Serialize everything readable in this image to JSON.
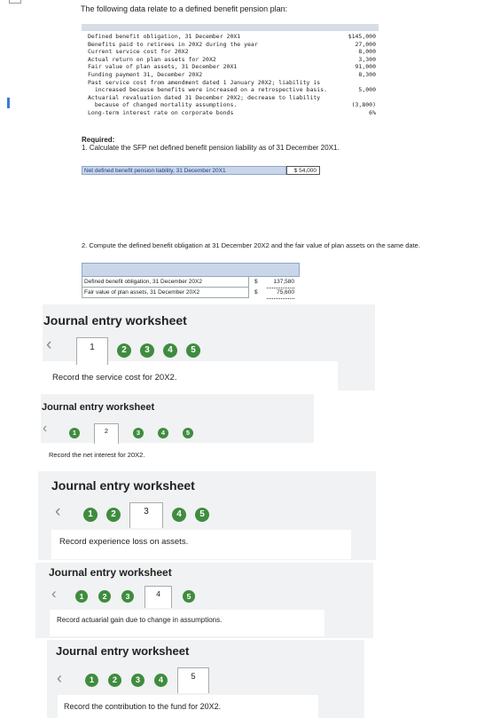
{
  "intro": "The following data relate to a defined benefit pension plan:",
  "data_table": [
    {
      "label": "Defined benefit obligation, 31 December 20X1",
      "value": "$145,000"
    },
    {
      "label": "Benefits paid to retirees in 20X2 during the year",
      "value": "27,000"
    },
    {
      "label": "Current service cost for 20X2",
      "value": "8,000"
    },
    {
      "label": "Actual return on plan assets for 20X2",
      "value": "3,300"
    },
    {
      "label": "Fair value of plan assets, 31 December 20X1",
      "value": "91,000"
    },
    {
      "label": "Funding payment 31, December 20X2",
      "value": "8,300"
    },
    {
      "label": "Past service cost from amendment dated 1 January 20X2; liability is",
      "value": ""
    },
    {
      "label": "  increased because benefits were increased on a retrospective basis.",
      "value": "5,000"
    },
    {
      "label": "Actuarial revaluation dated 31 December 20X2; decrease to liability",
      "value": ""
    },
    {
      "label": "  because of changed mortality assumptions.",
      "value": "(3,800)"
    },
    {
      "label": "Long-term interest rate on corporate bonds",
      "value": "6%"
    }
  ],
  "required": {
    "heading": "Required:",
    "q1": "1. Calculate the SFP net defined benefit pension liability as of 31 December 20X1.",
    "q1_label": "Net defined benefit pension liability, 31 December 20X1",
    "q1_value": "$ 54,000",
    "q2": "2. Compute the defined benefit obligation at 31 December 20X2 and the fair value of plan assets on the same date.",
    "q2_rows": [
      {
        "label": "Defined benefit obligation, 31 December 20X2",
        "currency": "$",
        "value": "137,580"
      },
      {
        "label": "Fair value of plan assets, 31 December 20X2",
        "currency": "$",
        "value": "75,600"
      }
    ]
  },
  "worksheets": [
    {
      "title": "Journal entry worksheet",
      "tabs": [
        "1",
        "2",
        "3",
        "4",
        "5"
      ],
      "active": 0,
      "task": "Record the service cost for 20X2."
    },
    {
      "title": "Journal entry worksheet",
      "tabs": [
        "1",
        "2",
        "3",
        "4",
        "5"
      ],
      "active": 1,
      "task": "Record the net interest for 20X2."
    },
    {
      "title": "Journal entry worksheet",
      "tabs": [
        "1",
        "2",
        "3",
        "4",
        "5"
      ],
      "active": 2,
      "task": "Record experience loss on assets."
    },
    {
      "title": "Journal entry worksheet",
      "tabs": [
        "1",
        "2",
        "3",
        "4",
        "5"
      ],
      "active": 3,
      "task": "Record actuarial gain due to change in assumptions."
    },
    {
      "title": "Journal entry worksheet",
      "tabs": [
        "1",
        "2",
        "3",
        "4",
        "5"
      ],
      "active": 4,
      "task": "Record the contribution to the fund for 20X2."
    }
  ],
  "icons": {
    "prev": "chevron-left-icon"
  }
}
